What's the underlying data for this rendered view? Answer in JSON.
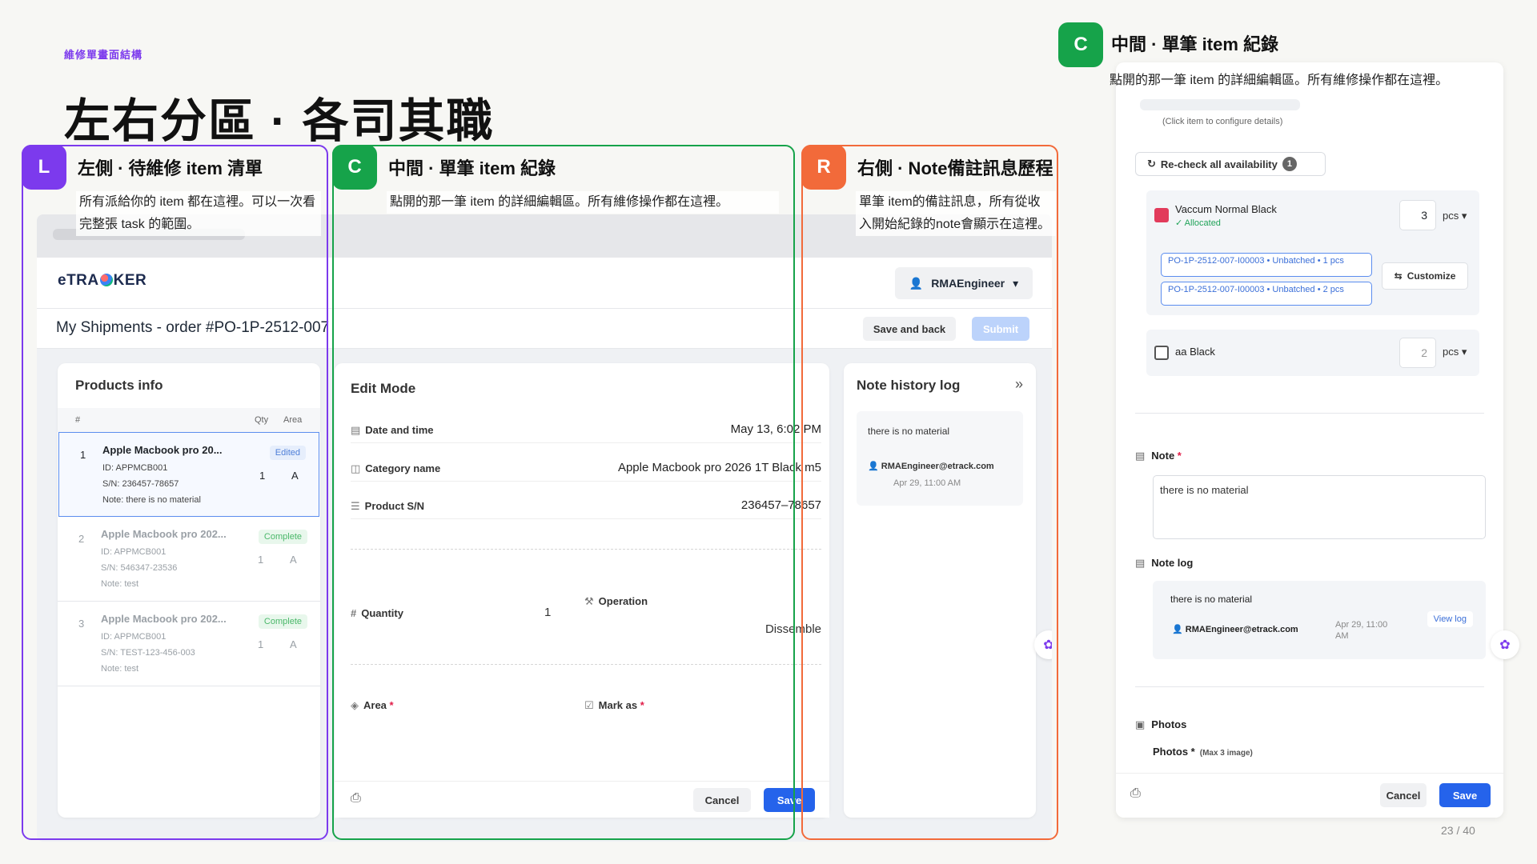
{
  "slide": {
    "eyebrow": "維修單畫面結構",
    "title": "左右分區 · 各司其職",
    "page": "23 / 40"
  },
  "zones": [
    {
      "tag": "L",
      "title": "左側 · 待維修 item 清單",
      "desc": "所有派給你的 item 都在這裡。可以一次看完整張 task 的範圍。",
      "color": "#7c3aed"
    },
    {
      "tag": "C",
      "title": "中間 · 單筆 item 紀錄",
      "desc": "點開的那一筆 item 的詳細編輯區。所有維修操作都在這裡。",
      "color": "#16a34a"
    },
    {
      "tag": "R",
      "title": "右側 · Note備註訊息歷程",
      "desc": "單筆 item的備註訊息，所有從收入開始紀錄的note會顯示在這裡。",
      "color": "#f26a3a"
    }
  ],
  "zoom_header": {
    "tag": "C",
    "title": "中間 · 單筆 item 紀錄",
    "desc": "點開的那一筆 item 的詳細編輯區。所有維修操作都在這裡。"
  },
  "app": {
    "logo": "eTRACKER",
    "user": "RMAEngineer",
    "order_title": "My Shipments - order #PO-1P-2512-007",
    "save_and_back": "Save and back",
    "submit": "Submit",
    "products": {
      "title": "Products info",
      "col_num": "#",
      "col_qty": "Qty",
      "col_area": "Area",
      "rows": [
        {
          "num": "1",
          "name": "Apple Macbook pro 20...",
          "id": "ID: APPMCB001",
          "sn": "S/N: 236457-78657",
          "note": "Note: there is no material",
          "qty": "1",
          "area": "A",
          "badge": "Edited"
        },
        {
          "num": "2",
          "name": "Apple Macbook pro 202...",
          "id": "ID: APPMCB001",
          "sn": "S/N: 546347-23536",
          "note": "Note: test",
          "qty": "1",
          "area": "A",
          "badge": "Complete"
        },
        {
          "num": "3",
          "name": "Apple Macbook pro 202...",
          "id": "ID: APPMCB001",
          "sn": "S/N: TEST-123-456-003",
          "note": "Note: test",
          "qty": "1",
          "area": "A",
          "badge": "Complete"
        }
      ]
    },
    "edit": {
      "title": "Edit Mode",
      "date_label": "Date and time",
      "date_value": "May 13, 6:02 PM",
      "category_label": "Category name",
      "category_value": "Apple Macbook pro 2026 1T Black m5",
      "sn_label": "Product S/N",
      "sn_value": "236457–78657",
      "quantity_label": "Quantity",
      "quantity_value": "1",
      "operation_label": "Operation",
      "operation_value": "Dissemble",
      "area_label": "Area",
      "mark_label": "Mark as",
      "cancel": "Cancel",
      "save": "Save"
    },
    "notes": {
      "title": "Note history log",
      "text": "there is no material",
      "author": "RMAEngineer@etrack.com",
      "time": "Apr 29, 11:00 AM"
    }
  },
  "zoom": {
    "click_hint": "(Click item to configure details)",
    "recheck": "Re-check all availability",
    "recheck_count": "1",
    "materials": [
      {
        "name": "Vaccum Normal Black",
        "status": "Allocated",
        "qty": "3",
        "unit": "pcs",
        "checked": true
      },
      {
        "name": "aa Black",
        "status": "",
        "qty": "2",
        "unit": "pcs",
        "checked": false
      }
    ],
    "batches": [
      "PO-1P-2512-007-I00003 • Unbatched • 1 pcs",
      "PO-1P-2512-007-I00003 • Unbatched • 2 pcs"
    ],
    "customize": "Customize",
    "note_label": "Note",
    "note_value": "there is no material",
    "note_log_label": "Note log",
    "log_text": "there is no material",
    "log_author": "RMAEngineer@etrack.com",
    "log_time": "Apr 29, 11:00 AM",
    "view_log": "View log",
    "photos_label": "Photos",
    "photos_sub": "Photos",
    "photos_hint": "(Max 3 image)",
    "cancel": "Cancel",
    "save": "Save"
  }
}
